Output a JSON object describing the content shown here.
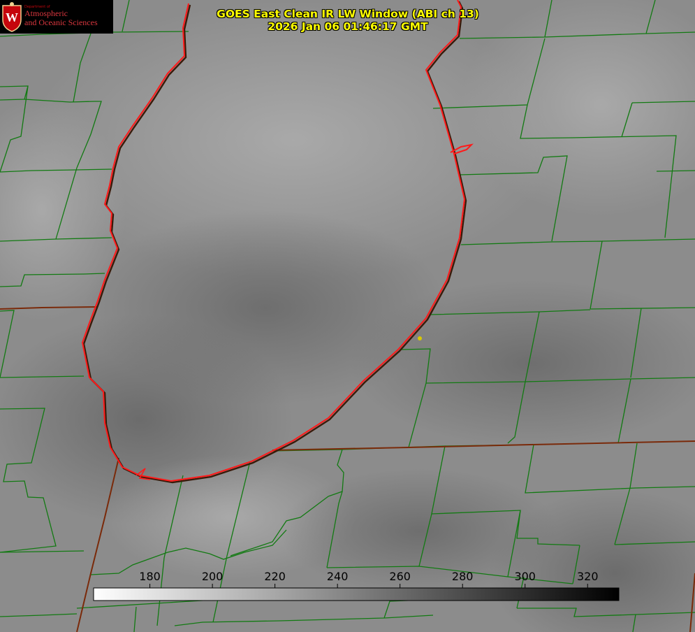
{
  "header": {
    "title_line1": "GOES East Clean IR LW Window (ABI ch 13)",
    "title_line2": "2026 Jan 06 01:46:17 GMT"
  },
  "logo": {
    "dept_small": "Department of",
    "line1": "Atmospheric",
    "line2": "and Oceanic Sciences",
    "emblem_letter": "W"
  },
  "colorbar": {
    "ticks": [
      "180",
      "200",
      "220",
      "240",
      "260",
      "280",
      "300",
      "320"
    ],
    "tick_values": [
      180,
      200,
      220,
      240,
      260,
      280,
      300,
      320
    ],
    "range_min": 162,
    "range_max": 330,
    "gradient_from": "#ffffff",
    "gradient_to": "#000000"
  },
  "colors": {
    "county_lines": "#127a12",
    "shoreline": "#ff1a1a",
    "state_line": "#7a2a0a",
    "title": "#ffff00",
    "station_marker": "#d8c800"
  }
}
